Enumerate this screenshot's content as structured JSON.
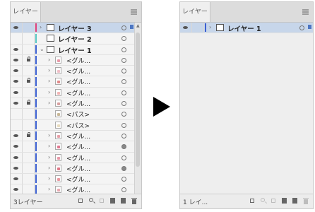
{
  "left": {
    "tab": "レイヤー",
    "footer_count": "3レイヤー",
    "rows": [
      {
        "eye": true,
        "lock": false,
        "color": "#e0407a",
        "indent": 0,
        "arrow": "›",
        "thumb": "box",
        "label": "レイヤー 3",
        "bold": true,
        "selected": true,
        "target": "ring",
        "sel": true
      },
      {
        "eye": false,
        "lock": false,
        "color": "#57c7c2",
        "indent": 0,
        "arrow": "",
        "thumb": "box",
        "label": "レイヤー 2",
        "bold": true,
        "selected": false,
        "target": "ring",
        "sel": false
      },
      {
        "eye": true,
        "lock": false,
        "color": "#3b5fd1",
        "indent": 0,
        "arrow": "⌄",
        "thumb": "box",
        "label": "レイヤー 1",
        "bold": true,
        "selected": false,
        "target": "ring",
        "sel": false
      },
      {
        "eye": true,
        "lock": true,
        "color": "#3b5fd1",
        "indent": 1,
        "arrow": "›",
        "thumb": "img",
        "mark": "#e89aa8",
        "label": "<グル...",
        "bold": false,
        "selected": false,
        "target": "ring",
        "sel": false
      },
      {
        "eye": true,
        "lock": false,
        "color": "#3b5fd1",
        "indent": 1,
        "arrow": "›",
        "thumb": "img",
        "mark": "#f0c0c8",
        "label": "<グル...",
        "bold": false,
        "selected": false,
        "target": "ring",
        "sel": false
      },
      {
        "eye": true,
        "lock": true,
        "color": "#3b5fd1",
        "indent": 1,
        "arrow": "›",
        "thumb": "img",
        "mark": "#e08a8a",
        "label": "<グル...",
        "bold": false,
        "selected": false,
        "target": "ring",
        "sel": false
      },
      {
        "eye": true,
        "lock": false,
        "color": "#3b5fd1",
        "indent": 1,
        "arrow": "›",
        "thumb": "img",
        "mark": "#f2b5b5",
        "label": "<グル...",
        "bold": false,
        "selected": false,
        "target": "ring",
        "sel": false
      },
      {
        "eye": true,
        "lock": true,
        "color": "#3b5fd1",
        "indent": 1,
        "arrow": "›",
        "thumb": "img",
        "mark": "#d8a0a0",
        "label": "<グル...",
        "bold": false,
        "selected": false,
        "target": "ring",
        "sel": false
      },
      {
        "eye": false,
        "lock": false,
        "color": "#3b5fd1",
        "indent": 1,
        "arrow": "",
        "thumb": "img",
        "mark": "#c8b898",
        "label": "<パス>",
        "bold": false,
        "selected": false,
        "target": "ring",
        "sel": false
      },
      {
        "eye": false,
        "lock": false,
        "color": "#3b5fd1",
        "indent": 1,
        "arrow": "",
        "thumb": "img",
        "mark": "#e8dcc0",
        "label": "<パス>",
        "bold": false,
        "selected": false,
        "target": "ring",
        "sel": false
      },
      {
        "eye": true,
        "lock": true,
        "color": "#3b5fd1",
        "indent": 1,
        "arrow": "›",
        "thumb": "img",
        "mark": "#e8a0a8",
        "label": "<グル...",
        "bold": false,
        "selected": false,
        "target": "ring",
        "sel": false
      },
      {
        "eye": true,
        "lock": false,
        "color": "#3b5fd1",
        "indent": 1,
        "arrow": "›",
        "thumb": "img",
        "mark": "#e07890",
        "label": "<グル...",
        "bold": false,
        "selected": false,
        "target": "filled",
        "sel": false
      },
      {
        "eye": true,
        "lock": false,
        "color": "#3b5fd1",
        "indent": 1,
        "arrow": "›",
        "thumb": "img",
        "mark": "#e898a8",
        "label": "<グル...",
        "bold": false,
        "selected": false,
        "target": "ring",
        "sel": false
      },
      {
        "eye": true,
        "lock": false,
        "color": "#3b5fd1",
        "indent": 1,
        "arrow": "›",
        "thumb": "img",
        "mark": "#e07888",
        "label": "<グル...",
        "bold": false,
        "selected": false,
        "target": "filled",
        "sel": false
      },
      {
        "eye": true,
        "lock": false,
        "color": "#3b5fd1",
        "indent": 1,
        "arrow": "›",
        "thumb": "img",
        "mark": "#ea98a0",
        "label": "<グル...",
        "bold": false,
        "selected": false,
        "target": "ring",
        "sel": false
      },
      {
        "eye": true,
        "lock": false,
        "color": "#3b5fd1",
        "indent": 1,
        "arrow": "›",
        "thumb": "img",
        "mark": "#e8a8b0",
        "label": "<グル...",
        "bold": false,
        "selected": false,
        "target": "ring",
        "sel": false
      }
    ]
  },
  "right": {
    "tab": "レイヤー",
    "footer_count": "1 レイ...",
    "rows": [
      {
        "eye": true,
        "lock": false,
        "color": "#3b5fd1",
        "indent": 0,
        "arrow": "›",
        "thumb": "box",
        "label": "レイヤー 1",
        "bold": true,
        "selected": true,
        "target": "ring",
        "sel": true
      }
    ]
  },
  "footer_icons": [
    "export-icon",
    "search-icon",
    "clip-icon",
    "sublayer-icon",
    "new-layer-icon",
    "trash-icon"
  ],
  "colors": {
    "selected_row": "#c7d6ea",
    "panel": "#eeeeee",
    "arrow": "#000000"
  }
}
